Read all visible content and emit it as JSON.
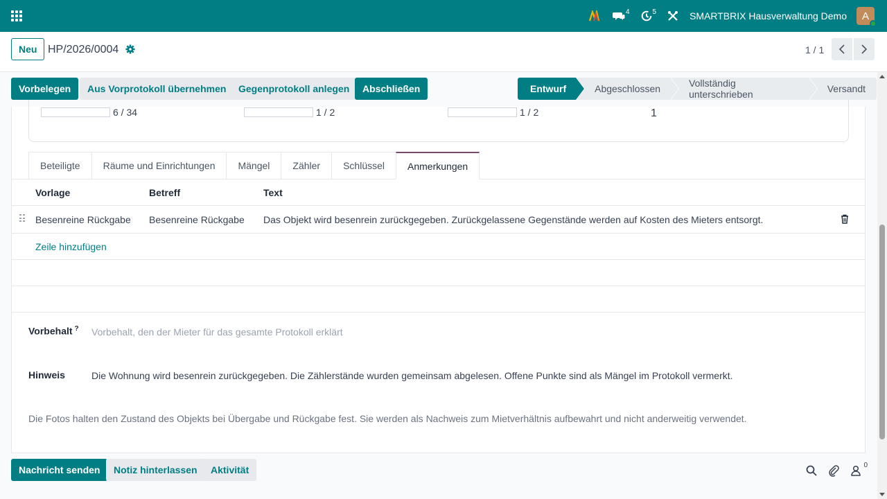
{
  "navbar": {
    "apps_icon": "grid-icon",
    "messages_badge": "4",
    "activities_badge": "5",
    "company": "SMARTBRIX Hausverwaltung Demo",
    "avatar_letter": "A",
    "accent_color": "#017e84"
  },
  "control_panel": {
    "new_label": "Neu",
    "record_name": "HP/2026/0004",
    "pager_value": "1 / 1"
  },
  "actions": {
    "prefill": "Vorbelegen",
    "from_previous": "Aus Vorprotokoll übernehmen",
    "counter_protocol": "Gegenprotokoll anlegen",
    "finish": "Abschließen"
  },
  "status_steps": [
    {
      "label": "Entwurf",
      "active": true
    },
    {
      "label": "Abgeschlossen",
      "active": false
    },
    {
      "label": "Vollständig unterschrieben",
      "active": false
    },
    {
      "label": "Versandt",
      "active": false
    }
  ],
  "stats": {
    "stat1": "6 / 34",
    "stat2": "1 / 2",
    "stat3": "1 / 2",
    "stat4": "1"
  },
  "tabs": [
    "Beteiligte",
    "Räume und Einrichtungen",
    "Mängel",
    "Zähler",
    "Schlüssel",
    "Anmerkungen"
  ],
  "active_tab": "Anmerkungen",
  "notes_table": {
    "columns": [
      "Vorlage",
      "Betreff",
      "Text"
    ],
    "rows": [
      {
        "template": "Besenreine Rückgabe",
        "subject": "Besenreine Rückgabe",
        "text": "Das Objekt wird besenrein zurückgegeben. Zurückgelassene Gegenstände werden auf Kosten des Mieters entsorgt."
      }
    ],
    "add_line": "Zeile hinzufügen"
  },
  "fields": {
    "reservation_label": "Vorbehalt",
    "reservation_help": "?",
    "reservation_placeholder": "Vorbehalt, den der Mieter für das gesamte Protokoll erklärt",
    "hint_label": "Hinweis",
    "hint_value": "Die Wohnung wird besenrein zurückgegeben. Die Zählerstände wurden gemeinsam abgelesen. Offene Punkte sind als Mängel im Protokoll vermerkt.",
    "photo_note": "Die Fotos halten den Zustand des Objekts bei Übergabe und Rückgabe fest. Sie werden als Nachweis zum Mietverhältnis aufbewahrt und nicht anderweitig verwendet."
  },
  "chatter": {
    "send_message": "Nachricht senden",
    "log_note": "Notiz hinterlassen",
    "activity": "Aktivität",
    "followers_count": "0"
  }
}
